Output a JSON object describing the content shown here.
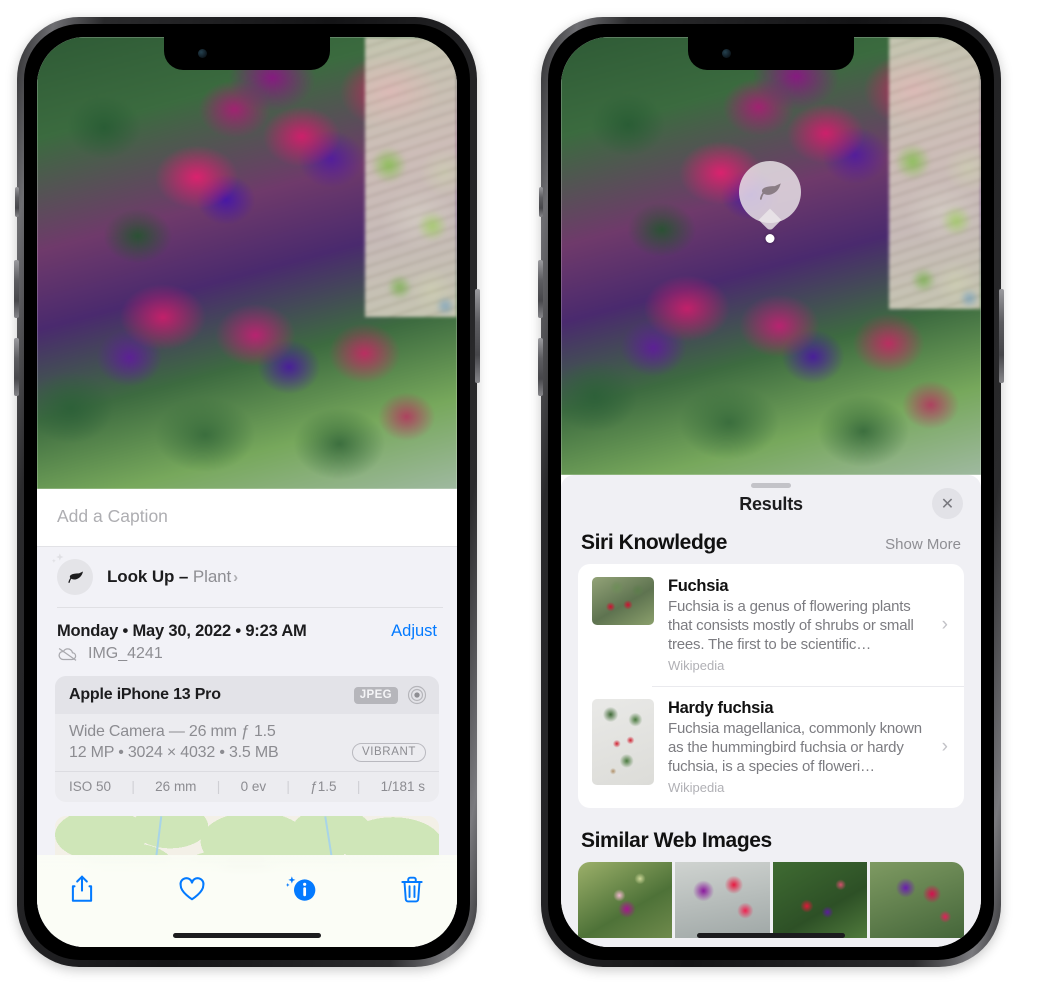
{
  "left_phone": {
    "photo": {
      "alt": "fuchsia-flowers-photo"
    },
    "caption_placeholder": "Add a Caption",
    "lookup": {
      "label": "Look Up – ",
      "subject": "Plant",
      "icon": "leaf-icon",
      "chevron": "›"
    },
    "date": "Monday • May 30, 2022 • 9:23 AM",
    "adjust_label": "Adjust",
    "filename": "IMG_4241",
    "filename_icon": "cloud-slash-icon",
    "camera_card": {
      "model": "Apple iPhone 13 Pro",
      "format_badge": "JPEG",
      "aperture_icon": "aperture-icon",
      "lens_line": "Wide Camera — 26 mm ƒ 1.5",
      "specs_line": "12 MP • 3024 × 4032 • 3.5 MB",
      "vibrant_badge": "VIBRANT",
      "exif": [
        "ISO 50",
        "26 mm",
        "0 ev",
        "ƒ1.5",
        "1/181 s"
      ]
    },
    "toolbar": [
      {
        "name": "share-icon",
        "label": "Share"
      },
      {
        "name": "heart-icon",
        "label": "Favorite"
      },
      {
        "name": "info-icon",
        "label": "Info"
      },
      {
        "name": "trash-icon",
        "label": "Delete"
      }
    ]
  },
  "right_phone": {
    "pin": {
      "icon": "leaf-icon"
    },
    "sheet": {
      "title": "Results",
      "close_label": "✕",
      "sections": [
        {
          "title": "Siri Knowledge",
          "action": "Show More",
          "items": [
            {
              "title": "Fuchsia",
              "description": "Fuchsia is a genus of flowering plants that consists mostly of shrubs or small trees. The first to be scientific…",
              "source": "Wikipedia",
              "chevron": "›"
            },
            {
              "title": "Hardy fuchsia",
              "description": "Fuchsia magellanica, commonly known as the hummingbird fuchsia or hardy fuchsia, is a species of floweri…",
              "source": "Wikipedia",
              "chevron": "›"
            }
          ]
        },
        {
          "title": "Similar Web Images",
          "images": 4
        }
      ]
    }
  },
  "colors": {
    "accent_blue": "#037aff",
    "panel_gray": "#f2f2f7",
    "sheet_gray": "#f0f0f4",
    "card_white": "#ffffff",
    "secondary_text": "#8e8e93"
  }
}
